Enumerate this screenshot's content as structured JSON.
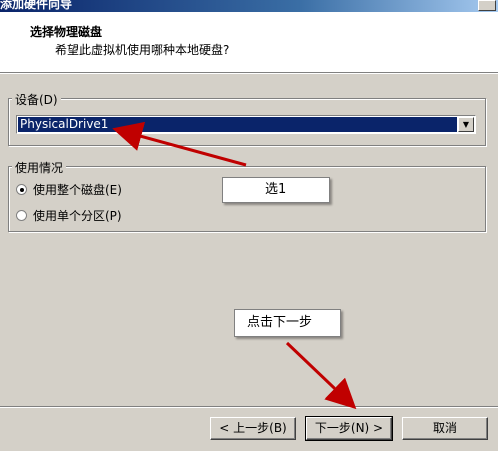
{
  "window": {
    "title": "添加硬件向导"
  },
  "header": {
    "title": "选择物理磁盘",
    "subtitle": "希望此虚拟机使用哪种本地硬盘?"
  },
  "device_group": {
    "label": "设备(D)",
    "selected_value": "PhysicalDrive1"
  },
  "usage_group": {
    "label": "使用情况",
    "options": [
      {
        "label": "使用整个磁盘(E)",
        "checked": true
      },
      {
        "label": "使用单个分区(P)",
        "checked": false
      }
    ]
  },
  "annotations": {
    "callout_select": "选1",
    "callout_next": "点击下一步",
    "arrow_color": "#c00000"
  },
  "buttons": {
    "back": "< 上一步(B)",
    "next": "下一步(N) >",
    "cancel": "取消"
  },
  "colors": {
    "selection": "#0a246a",
    "dialog_bg": "#d4d0c8"
  }
}
